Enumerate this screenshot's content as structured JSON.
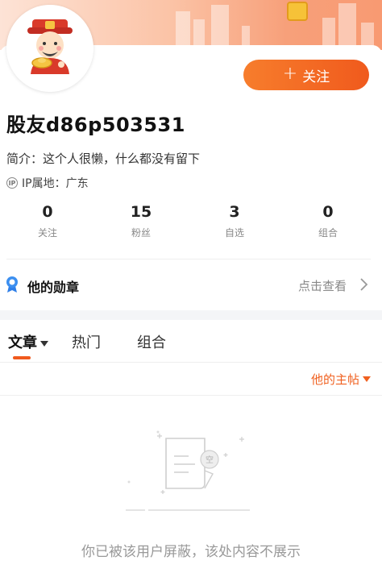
{
  "profile": {
    "username": "股友d86p503531",
    "bio": "简介：这个人很懒，什么都没有留下",
    "ip_location": "IP属地：广东",
    "follow_button": "关注"
  },
  "stats": [
    {
      "value": "0",
      "label": "关注"
    },
    {
      "value": "15",
      "label": "粉丝"
    },
    {
      "value": "3",
      "label": "自选"
    },
    {
      "value": "0",
      "label": "组合"
    }
  ],
  "medal": {
    "title": "他的勋章",
    "link": "点击查看"
  },
  "tabs": [
    {
      "label": "文章",
      "active": true
    },
    {
      "label": "热门",
      "active": false
    },
    {
      "label": "组合",
      "active": false
    }
  ],
  "sort": {
    "label": "他的主帖"
  },
  "empty": {
    "badge": "空",
    "message": "你已被该用户屏蔽，该处内容不展示"
  },
  "colors": {
    "accent": "#f05a1d",
    "banner": "#f89a72",
    "muted_text": "#999999"
  },
  "icons": [
    "avatar-god-of-wealth",
    "plus-icon",
    "ip-icon",
    "medal-icon",
    "chevron-right-icon",
    "tab-caret-icon",
    "sort-caret-icon",
    "empty-document-icon"
  ]
}
